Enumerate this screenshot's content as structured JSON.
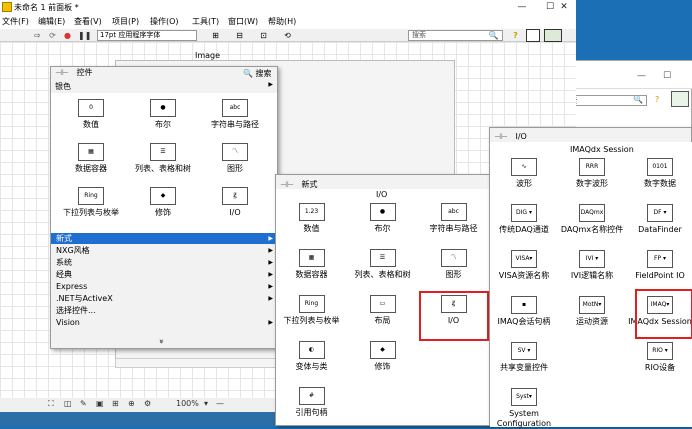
{
  "window": {
    "title": "未命名 1 前面板 *",
    "minimize": "—",
    "maximize": "☐",
    "close": "✕"
  },
  "menu": [
    "文件(F)",
    "编辑(E)",
    "查看(V)",
    "项目(P)",
    "操作(O)",
    "工具(T)",
    "窗口(W)",
    "帮助(H)"
  ],
  "toolbar": {
    "font": "17pt 应用程序字体",
    "search_placeholder": "搜索"
  },
  "canvas": {
    "image_label": "Image"
  },
  "status": {
    "zoom": "100%"
  },
  "bgwin": {
    "search_placeholder": "索"
  },
  "palette1": {
    "title": "控件",
    "search_label": "搜索",
    "category": "银色",
    "items": [
      {
        "label": "数值",
        "icon": "0"
      },
      {
        "label": "布尔",
        "icon": "●"
      },
      {
        "label": "字符串与路径",
        "icon": "abc"
      },
      {
        "label": "数据容器",
        "icon": "▦"
      },
      {
        "label": "列表、表格和树",
        "icon": "☰"
      },
      {
        "label": "图形",
        "icon": "〽"
      },
      {
        "label": "下拉列表与枚举",
        "icon": "Ring"
      },
      {
        "label": "修饰",
        "icon": "◆"
      },
      {
        "label": "I/O",
        "icon": "Ꙃ"
      }
    ],
    "list": [
      {
        "label": "新式",
        "sub": true,
        "selected": true
      },
      {
        "label": "NXG风格",
        "sub": true
      },
      {
        "label": "系统",
        "sub": true
      },
      {
        "label": "经典",
        "sub": true
      },
      {
        "label": "Express",
        "sub": true
      },
      {
        "label": ".NET与ActiveX",
        "sub": true
      },
      {
        "label": "选择控件...",
        "sub": false
      },
      {
        "label": "Vision",
        "sub": true
      }
    ],
    "more": "»"
  },
  "palette2": {
    "title": "新式",
    "section": "I/O",
    "items": [
      {
        "label": "数值",
        "icon": "1.23"
      },
      {
        "label": "布尔",
        "icon": "●"
      },
      {
        "label": "字符串与路径",
        "icon": "abc"
      },
      {
        "label": "数据容器",
        "icon": "▦"
      },
      {
        "label": "列表、表格和树",
        "icon": "☰"
      },
      {
        "label": "图形",
        "icon": "〽"
      },
      {
        "label": "下拉列表与枚举",
        "icon": "Ring"
      },
      {
        "label": "布局",
        "icon": "▭"
      },
      {
        "label": "I/O",
        "icon": "Ꙃ"
      },
      {
        "label": "变体与类",
        "icon": "◐"
      },
      {
        "label": "修饰",
        "icon": "◆"
      },
      {
        "label": "",
        "icon": ""
      },
      {
        "label": "引用句柄",
        "icon": "#"
      }
    ]
  },
  "palette3": {
    "title": "I/O",
    "section": "IMAQdx Session",
    "items": [
      {
        "label": "波形",
        "icon": "∿"
      },
      {
        "label": "数字波形",
        "icon": "RRR"
      },
      {
        "label": "数字数据",
        "icon": "0101"
      },
      {
        "label": "传统DAQ通道",
        "icon": "DIG ▾"
      },
      {
        "label": "DAQmx名称控件",
        "icon": "DAQmx"
      },
      {
        "label": "DataFinder",
        "icon": "DF ▾"
      },
      {
        "label": "VISA资源名称",
        "icon": "VISA▾"
      },
      {
        "label": "IVI逻辑名称",
        "icon": "IVI ▾"
      },
      {
        "label": "FieldPoint IO",
        "icon": "FP ▾"
      },
      {
        "label": "IMAQ会话句柄",
        "icon": "▪"
      },
      {
        "label": "运动资源",
        "icon": "MotN▾"
      },
      {
        "label": "IMAQdx Session",
        "icon": "IMAQ▾"
      },
      {
        "label": "共享变量控件",
        "icon": "SV ▾"
      },
      {
        "label": "",
        "icon": ""
      },
      {
        "label": "RIO设备",
        "icon": "RIO ▾"
      },
      {
        "label": "System Configuration",
        "icon": "Syst▾"
      }
    ]
  }
}
